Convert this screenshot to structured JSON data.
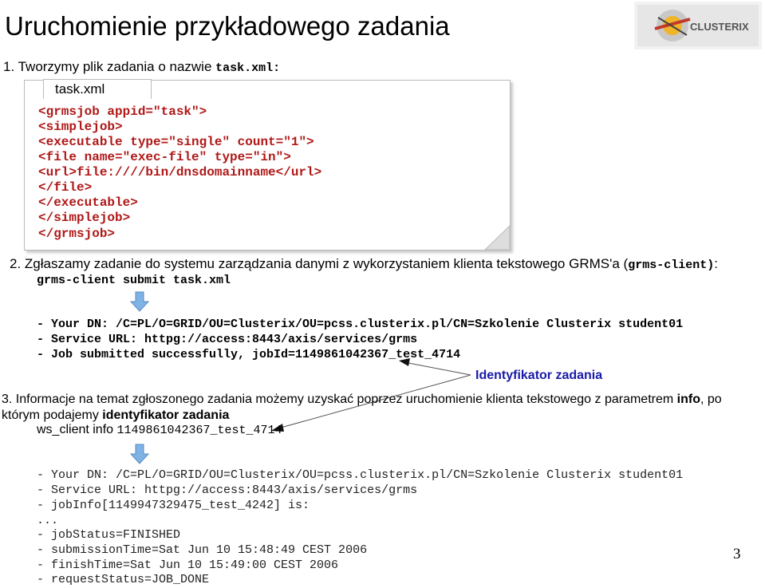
{
  "title": "Uruchomienie przykładowego zadania",
  "step1": {
    "text": "1. Tworzymy plik zadania o nazwie ",
    "filename": "task.xml:"
  },
  "doc": {
    "tab_label": "task.xml",
    "lines": [
      "<grmsjob appid=\"task\">",
      "  <simplejob>",
      "    <executable type=\"single\" count=\"1\">",
      "      <file name=\"exec-file\" type=\"in\">",
      "        <url>file:////bin/dnsdomainname</url>",
      "      </file>",
      "    </executable>",
      "  </simplejob>",
      "</grmsjob>"
    ]
  },
  "step2": {
    "text": "2. Zgłaszamy zadanie do systemu zarządzania danymi z wykorzystaniem klienta tekstowego GRMS'a (",
    "client": "grms-client)",
    "after": ":",
    "command": "grms-client submit task.xml"
  },
  "output1": [
    "- Your DN: /C=PL/O=GRID/OU=Clusterix/OU=pcss.clusterix.pl/CN=Szkolenie Clusterix student01",
    "- Service URL: httpg://access:8443/axis/services/grms",
    "- Job submitted successfully, jobId=1149861042367_test_4714"
  ],
  "annotation": "Identyfikator zadania",
  "step3": {
    "line1_a": "3. Informacje na temat zgłoszonego zadania możemy uzyskać poprzez uruchomienie klienta tekstowego z parametrem ",
    "line1_b": "info",
    "line1_c": ", po",
    "line2_a": "którym podajemy ",
    "line2_b": "identyfikator zadania",
    "cmd_prefix": "ws_client info ",
    "cmd_id": "1149861042367_test_4714"
  },
  "output2": [
    "- Your DN: /C=PL/O=GRID/OU=Clusterix/OU=pcss.clusterix.pl/CN=Szkolenie Clusterix student01",
    "- Service URL: httpg://access:8443/axis/services/grms",
    "- jobInfo[1149947329475_test_4242] is:",
    "...",
    "- jobStatus=FINISHED",
    "- submissionTime=Sat Jun 10 15:48:49 CEST 2006",
    "- finishTime=Sat Jun 10 15:49:00 CEST 2006",
    "- requestStatus=JOB_DONE"
  ],
  "logo_text": "CLUSTERIX",
  "page_number": "3",
  "colors": {
    "xml": "#b01818",
    "annotation": "#1a1aa8",
    "arrow": "#7fb3e6"
  }
}
